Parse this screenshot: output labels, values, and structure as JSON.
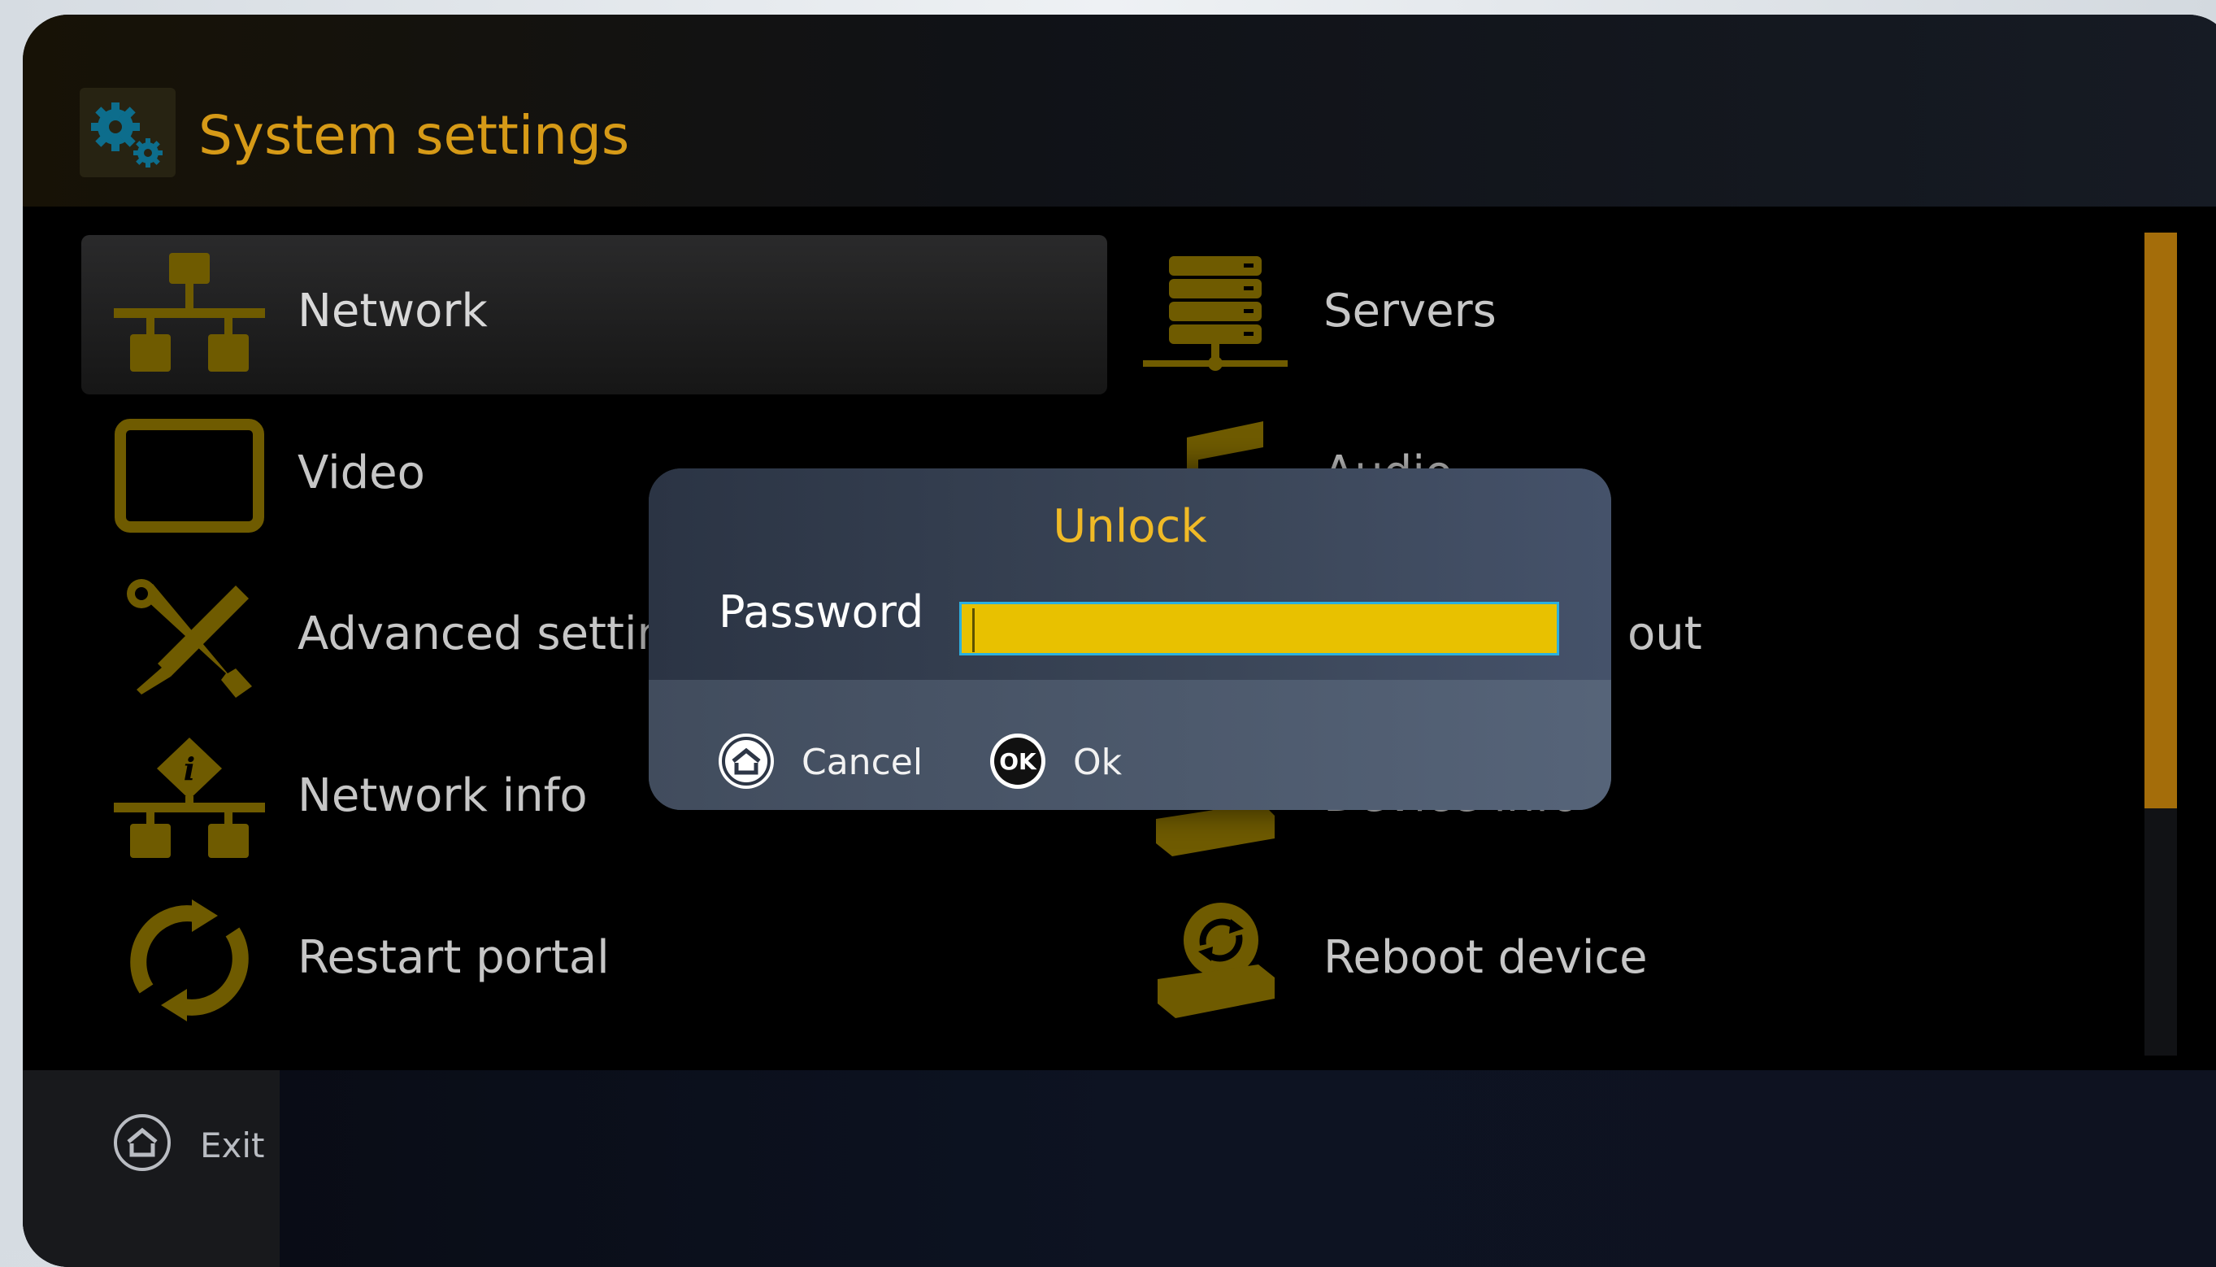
{
  "header": {
    "title": "System settings",
    "icon": "gears-icon"
  },
  "menu": {
    "items": [
      {
        "label": "Network",
        "icon": "network-icon",
        "selected": true
      },
      {
        "label": "Servers",
        "icon": "servers-icon"
      },
      {
        "label": "Video",
        "icon": "tv-icon"
      },
      {
        "label": "Audio",
        "icon": "music-note-icon"
      },
      {
        "label": "Advanced settin",
        "icon": "tools-icon"
      },
      {
        "label": "out",
        "icon": "layout-icon"
      },
      {
        "label": "Network info",
        "icon": "network-info-icon"
      },
      {
        "label": "Device info",
        "icon": "device-info-icon"
      },
      {
        "label": "Restart portal",
        "icon": "restart-icon"
      },
      {
        "label": "Reboot device",
        "icon": "reboot-device-icon"
      }
    ],
    "scroll_fraction_visible": 0.7
  },
  "dialog": {
    "title": "Unlock",
    "password_label": "Password",
    "password_value": "",
    "cancel_label": "Cancel",
    "ok_label": "Ok",
    "ok_icon_text": "OK"
  },
  "footer": {
    "exit_label": "Exit"
  },
  "colors": {
    "accent": "#d69a17",
    "icon_gold": "#6f5b00",
    "field": "#e8c100",
    "field_border": "#2bb0e0"
  }
}
